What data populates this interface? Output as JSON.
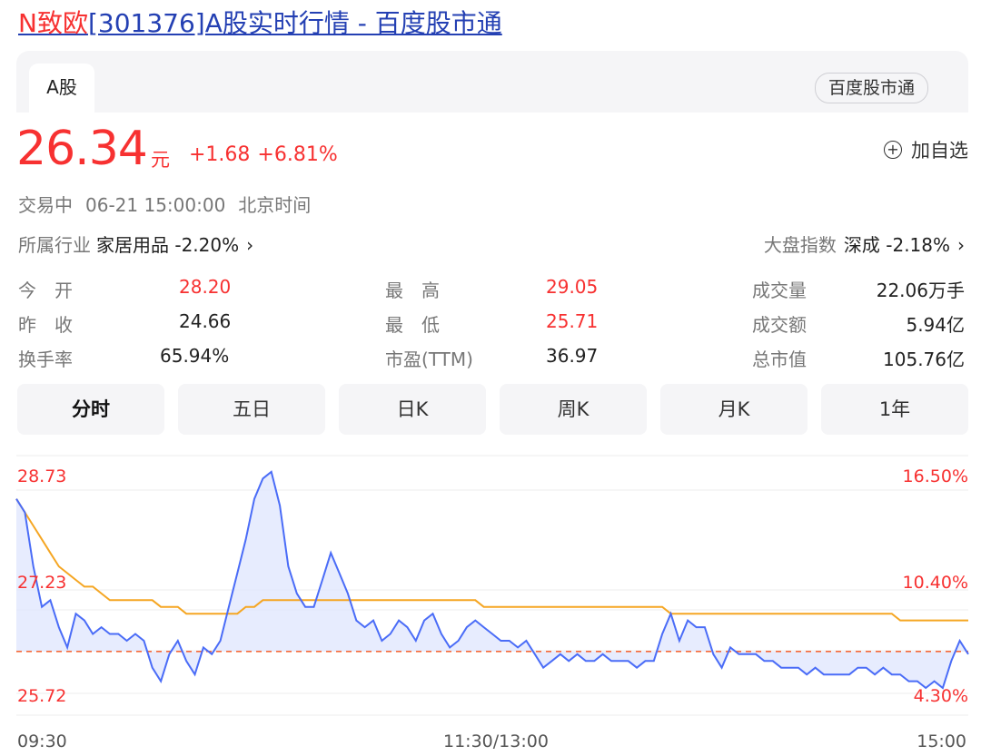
{
  "title": {
    "highlight": "N致欧",
    "rest": "[301376]A股实时行情 - 百度股市通"
  },
  "tabs": {
    "a_share": "A股",
    "source_button": "百度股市通"
  },
  "quote": {
    "price": "26.34",
    "unit": "元",
    "change": "+1.68",
    "change_pct": "+6.81%",
    "add_watchlist": "加自选"
  },
  "status": {
    "state": "交易中",
    "datetime": "06-21 15:00:00",
    "timezone": "北京时间"
  },
  "industry": {
    "label": "所属行业",
    "value": "家居用品 -2.20%"
  },
  "market_index": {
    "label": "大盘指数",
    "value": "深成 -2.18%"
  },
  "stats": {
    "open_label": "今　开",
    "open": "28.20",
    "prev_close_label": "昨　收",
    "prev_close": "24.66",
    "turnover_label": "换手率",
    "turnover": "65.94%",
    "high_label": "最　高",
    "high": "29.05",
    "low_label": "最　低",
    "low": "25.71",
    "pe_label": "市盈(TTM)",
    "pe": "36.97",
    "volume_label": "成交量",
    "volume": "22.06万手",
    "amount_label": "成交额",
    "amount": "5.94亿",
    "mktcap_label": "总市值",
    "mktcap": "105.76亿"
  },
  "chart_tabs": [
    "分时",
    "五日",
    "日K",
    "周K",
    "月K",
    "1年"
  ],
  "chart_data": {
    "type": "line",
    "y_left_ticks": [
      "28.73",
      "27.23",
      "25.72"
    ],
    "y_right_ticks": [
      "16.50%",
      "10.40%",
      "4.30%"
    ],
    "x_ticks": [
      "09:30",
      "11:30/13:00",
      "15:00"
    ],
    "ylim": [
      25.72,
      28.73
    ],
    "baseline": 26.34,
    "colors": {
      "price": "#4a6cf7",
      "avg": "#f5a623",
      "baseline": "#f56a3a",
      "fill": "#dfe6fd"
    },
    "series": [
      {
        "values": [
          28.6,
          28.4,
          27.6,
          27.0,
          27.1,
          26.7,
          26.4,
          26.9,
          26.8,
          26.6,
          26.7,
          26.6,
          26.6,
          26.5,
          26.6,
          26.5,
          26.1,
          25.9,
          26.3,
          26.5,
          26.2,
          26.0,
          26.4,
          26.3,
          26.5,
          27.0,
          27.5,
          28.0,
          28.6,
          28.9,
          29.0,
          28.5,
          27.6,
          27.2,
          27.0,
          27.0,
          27.4,
          27.8,
          27.5,
          27.2,
          26.8,
          26.7,
          26.8,
          26.5,
          26.6,
          26.8,
          26.7,
          26.5,
          26.8,
          26.9,
          26.6,
          26.4,
          26.5,
          26.7,
          26.8,
          26.7,
          26.6,
          26.5,
          26.5,
          26.4,
          26.5,
          26.3,
          26.1,
          26.2,
          26.3,
          26.2,
          26.3,
          26.2,
          26.2,
          26.3,
          26.2,
          26.2,
          26.2,
          26.1,
          26.2,
          26.2,
          26.6,
          26.9,
          26.5,
          26.8,
          26.7,
          26.7,
          26.3,
          26.1,
          26.4,
          26.3,
          26.3,
          26.3,
          26.2,
          26.2,
          26.1,
          26.1,
          26.1,
          26.0,
          26.1,
          26.0,
          26.0,
          26.0,
          26.0,
          26.1,
          26.1,
          26.0,
          26.1,
          26.0,
          26.0,
          25.9,
          25.9,
          25.8,
          25.9,
          25.8,
          26.2,
          26.5,
          26.3
        ]
      },
      {
        "values": [
          28.6,
          28.4,
          28.2,
          28.0,
          27.8,
          27.6,
          27.5,
          27.4,
          27.3,
          27.3,
          27.2,
          27.1,
          27.1,
          27.1,
          27.1,
          27.1,
          27.1,
          27.0,
          27.0,
          27.0,
          26.9,
          26.9,
          26.9,
          26.9,
          26.9,
          26.9,
          26.9,
          27.0,
          27.0,
          27.1,
          27.1,
          27.1,
          27.1,
          27.1,
          27.1,
          27.1,
          27.1,
          27.1,
          27.1,
          27.1,
          27.1,
          27.1,
          27.1,
          27.1,
          27.1,
          27.1,
          27.1,
          27.1,
          27.1,
          27.1,
          27.1,
          27.1,
          27.1,
          27.1,
          27.1,
          27.0,
          27.0,
          27.0,
          27.0,
          27.0,
          27.0,
          27.0,
          27.0,
          27.0,
          27.0,
          27.0,
          27.0,
          27.0,
          27.0,
          27.0,
          27.0,
          27.0,
          27.0,
          27.0,
          27.0,
          27.0,
          27.0,
          26.9,
          26.9,
          26.9,
          26.9,
          26.9,
          26.9,
          26.9,
          26.9,
          26.9,
          26.9,
          26.9,
          26.9,
          26.9,
          26.9,
          26.9,
          26.9,
          26.9,
          26.9,
          26.9,
          26.9,
          26.9,
          26.9,
          26.9,
          26.9,
          26.9,
          26.9,
          26.9,
          26.8,
          26.8,
          26.8,
          26.8,
          26.8,
          26.8,
          26.8,
          26.8,
          26.8
        ]
      }
    ]
  }
}
